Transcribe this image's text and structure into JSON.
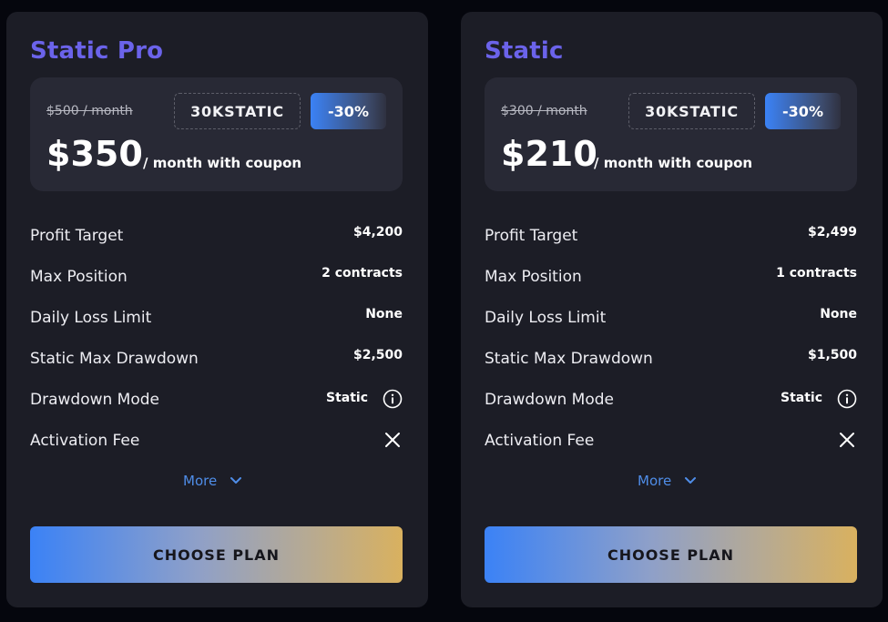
{
  "colors": {
    "background": "#05060d",
    "card": "#1c1d26",
    "price_box": "#282935",
    "plan_title": "#6b63ea",
    "link": "#4f8de8",
    "button_gradient_start": "#3b82f6",
    "button_gradient_end": "#d9b15f"
  },
  "plans": [
    {
      "title": "Static Pro",
      "original_price": "$500 / month",
      "coupon_code": "30KSTATIC",
      "discount": "-30%",
      "price": "$350",
      "price_suffix": "/ month with coupon",
      "rows": [
        {
          "label": "Profit Target",
          "value": "$4,200"
        },
        {
          "label": "Max Position",
          "value": "2 contracts"
        },
        {
          "label": "Daily Loss Limit",
          "value": "None"
        },
        {
          "label": "Static Max Drawdown",
          "value": "$2,500"
        },
        {
          "label": "Drawdown Mode",
          "value": "Static",
          "icon": "info-icon"
        },
        {
          "label": "Activation Fee",
          "icon": "close-x-icon"
        }
      ],
      "more_label": "More",
      "button_label": "CHOOSE PLAN"
    },
    {
      "title": "Static",
      "original_price": "$300 / month",
      "coupon_code": "30KSTATIC",
      "discount": "-30%",
      "price": "$210",
      "price_suffix": "/ month with coupon",
      "rows": [
        {
          "label": "Profit Target",
          "value": "$2,499"
        },
        {
          "label": "Max Position",
          "value": "1 contracts"
        },
        {
          "label": "Daily Loss Limit",
          "value": "None"
        },
        {
          "label": "Static Max Drawdown",
          "value": "$1,500"
        },
        {
          "label": "Drawdown Mode",
          "value": "Static",
          "icon": "info-icon"
        },
        {
          "label": "Activation Fee",
          "icon": "close-x-icon"
        }
      ],
      "more_label": "More",
      "button_label": "CHOOSE PLAN"
    }
  ]
}
